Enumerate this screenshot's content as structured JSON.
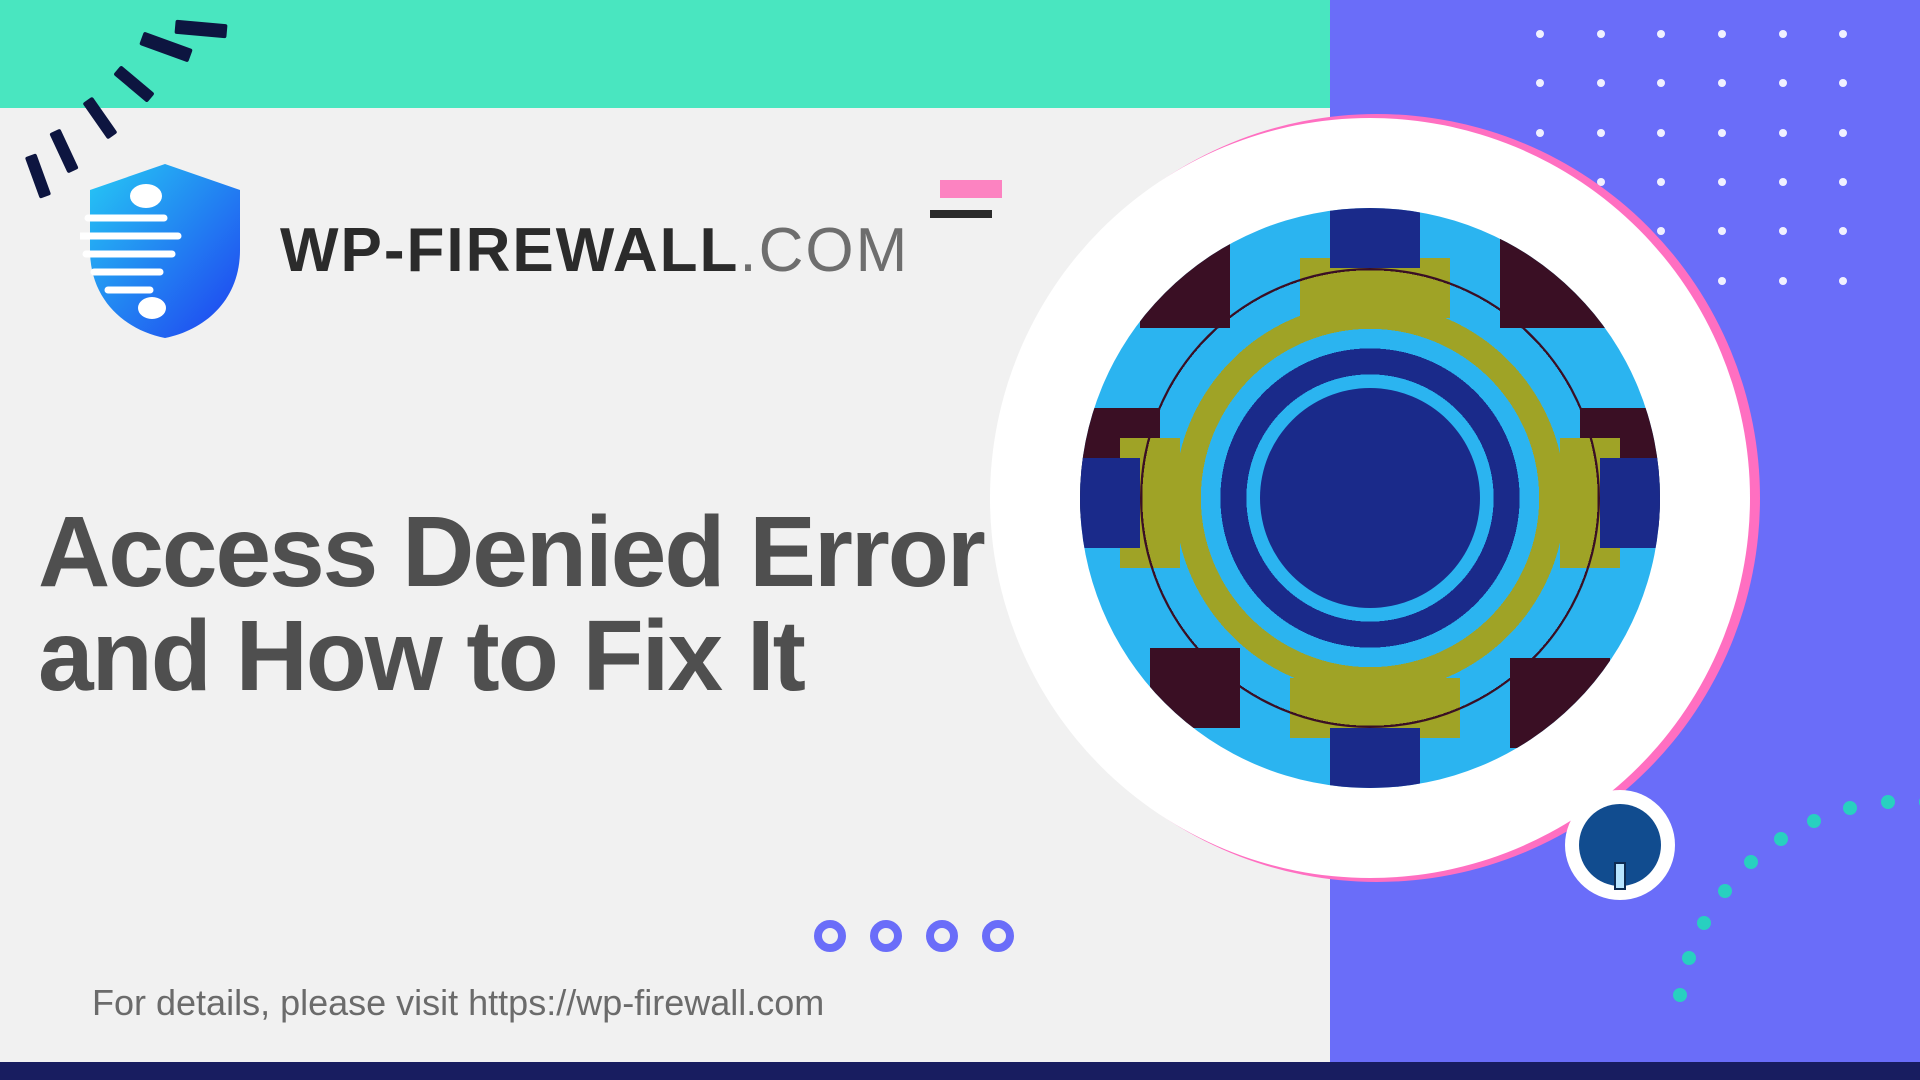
{
  "brand": {
    "name_bold": "WP-FIREWALL",
    "name_suffix": ".COM"
  },
  "headline": {
    "line1": "Access Denied Error",
    "line2": "and How to Fix It"
  },
  "footer": {
    "text": "For details, please visit https://wp-firewall.com"
  },
  "colors": {
    "teal": "#49e6c0",
    "purple": "#6a6df9",
    "pink": "#fc83c1",
    "navy": "#1a2a8a",
    "olive": "#9fa326",
    "magenta_dark": "#3a0f24",
    "cyan": "#2bb4f0",
    "text_dark": "#4f4f4f",
    "text_muted": "#6b6b6b"
  }
}
